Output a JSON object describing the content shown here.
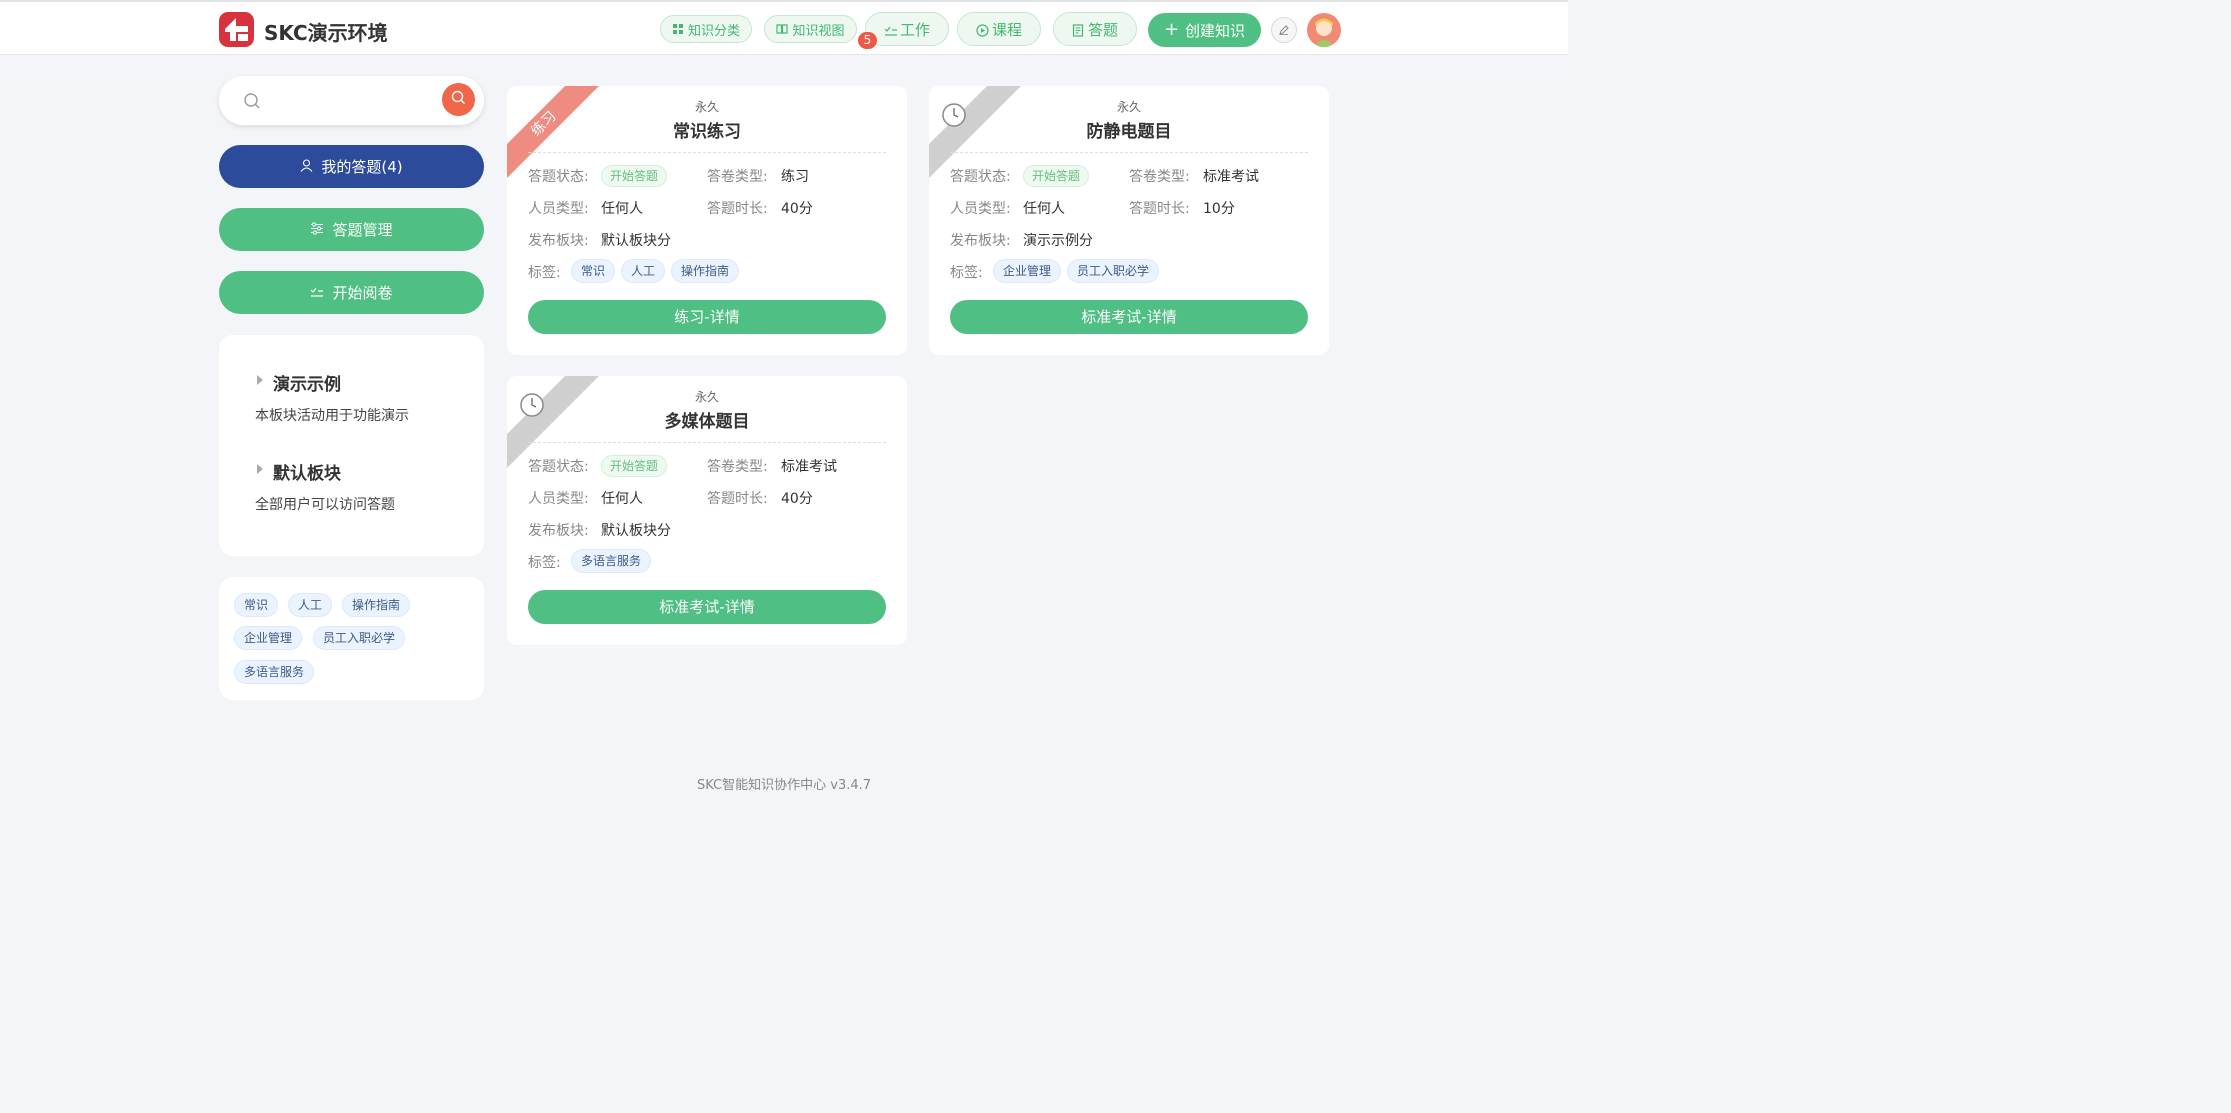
{
  "header": {
    "brand": "SKC演示环境",
    "nav": [
      {
        "label": "知识分类",
        "icon": "grid-icon"
      },
      {
        "label": "知识视图",
        "icon": "book-icon"
      },
      {
        "label": "工作",
        "icon": "check-list-icon",
        "badge": "5"
      },
      {
        "label": "课程",
        "icon": "play-circle-icon"
      },
      {
        "label": "答题",
        "icon": "exam-icon"
      }
    ],
    "create_label": "创建知识",
    "accent": "#4fbf83"
  },
  "search": {
    "placeholder": "",
    "value": ""
  },
  "sidebar": {
    "my_answers": "我的答题(4)",
    "manage": "答题管理",
    "review": "开始阅卷",
    "blocks": [
      {
        "title": "演示示例",
        "desc": "本板块活动用于功能演示"
      },
      {
        "title": "默认板块",
        "desc": "全部用户可以访问答题"
      }
    ],
    "tags": [
      "常识",
      "人工",
      "操作指南",
      "企业管理",
      "员工入职必学",
      "多语言服务"
    ]
  },
  "labels": {
    "status": "答题状态:",
    "paper_type": "答卷类型:",
    "person_type": "人员类型:",
    "duration": "答题时长:",
    "board": "发布板块:",
    "tags": "标签:"
  },
  "cards": [
    {
      "ribbon": "练习",
      "validity": "永久",
      "title": "常识练习",
      "status": "开始答题",
      "paper_type": "练习",
      "person_type": "任何人",
      "duration": "40分",
      "board": "默认板块分",
      "tags": [
        "常识",
        "人工",
        "操作指南"
      ],
      "button": "练习-详情"
    },
    {
      "ribbon": "",
      "validity": "永久",
      "title": "防静电题目",
      "status": "开始答题",
      "paper_type": "标准考试",
      "person_type": "任何人",
      "duration": "10分",
      "board": "演示示例分",
      "tags": [
        "企业管理",
        "员工入职必学"
      ],
      "button": "标准考试-详情"
    },
    {
      "ribbon": "",
      "validity": "永久",
      "title": "多媒体题目",
      "status": "开始答题",
      "paper_type": "标准考试",
      "person_type": "任何人",
      "duration": "40分",
      "board": "默认板块分",
      "tags": [
        "多语言服务"
      ],
      "button": "标准考试-详情"
    }
  ],
  "footer": "SKC智能知识协作中心 v3.4.7"
}
